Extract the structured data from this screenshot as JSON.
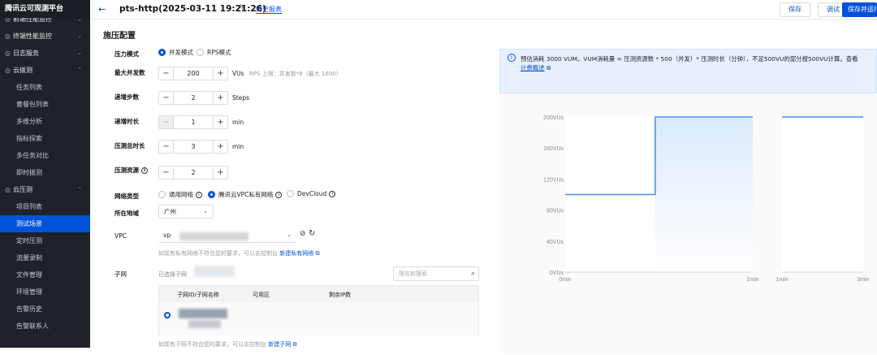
{
  "sidebar": {
    "logo": "腾讯云可观测平台",
    "items": [
      {
        "label": "前端性能监控",
        "kind": "group-cut",
        "icon": "web-icon"
      },
      {
        "label": "终端性能监控",
        "kind": "group",
        "icon": "terminal-icon"
      },
      {
        "label": "日志服务",
        "kind": "group",
        "icon": "log-icon"
      },
      {
        "label": "云拨测",
        "kind": "group-open",
        "icon": "dial-icon"
      },
      {
        "label": "任务列表",
        "kind": "sub"
      },
      {
        "label": "套餐包列表",
        "kind": "sub"
      },
      {
        "label": "多维分析",
        "kind": "sub"
      },
      {
        "label": "指标探索",
        "kind": "sub"
      },
      {
        "label": "多任务对比",
        "kind": "sub"
      },
      {
        "label": "即时拨测",
        "kind": "sub"
      },
      {
        "label": "云压测",
        "kind": "group-open",
        "icon": "stress-icon"
      },
      {
        "label": "项目列表",
        "kind": "sub"
      },
      {
        "label": "测试场景",
        "kind": "sub",
        "active": true
      },
      {
        "label": "定时压测",
        "kind": "sub"
      },
      {
        "label": "流量录制",
        "kind": "sub"
      },
      {
        "label": "文件管理",
        "kind": "sub"
      },
      {
        "label": "环境管理",
        "kind": "sub"
      },
      {
        "label": "告警历史",
        "kind": "sub"
      },
      {
        "label": "告警联系人",
        "kind": "sub"
      }
    ]
  },
  "header": {
    "back_icon": "arrow-left-icon",
    "title": "pts-http(2025-03-11 19:21:26)",
    "history_link": "历史报表",
    "buttons": {
      "save": "保存",
      "debug": "调试",
      "save_run": "保存并运行"
    }
  },
  "form": {
    "section_title": "施压配置",
    "mode": {
      "label": "压力模式",
      "options": [
        "并发模式",
        "RPS模式"
      ],
      "selected": 0
    },
    "max_concurrency": {
      "label": "最大并发数",
      "value": "200",
      "unit": "VUs",
      "hint": "RPS 上限：并发数*8（最大 1600）"
    },
    "ramp_steps": {
      "label": "递增步数",
      "value": "2",
      "unit": "Steps"
    },
    "ramp_duration": {
      "label": "递增时长",
      "value": "1",
      "unit": "min"
    },
    "total_duration": {
      "label": "压测总时长",
      "value": "3",
      "unit": "min"
    },
    "resources": {
      "label": "压测资源",
      "value": "2"
    },
    "network": {
      "label": "网络类型",
      "options": [
        "通用网络",
        "腾讯云VPC私有网络",
        "DevCloud"
      ],
      "selected": 1
    },
    "region": {
      "label": "所在地域",
      "value": "广州"
    },
    "vpc": {
      "label": "VPC",
      "value": "vp",
      "hint": "如现有私有网络不符合您的要求，可以去控制台",
      "link": "新建私有网络"
    },
    "subnet": {
      "label": "子网",
      "selected_text": "已选择子网",
      "search_placeholder": "搜名称搜索",
      "columns": [
        "子网ID/子网名称",
        "可用区",
        "剩余IP数"
      ],
      "hint": "如现有子网不符合您的要求，可以去控制台",
      "link": "新建子网"
    }
  },
  "notice": {
    "text": "预估消耗 3000 VUM。VUM消耗量 = 压测资源数 * 500（并发）* 压测时长（分钟），不足500VU的部分按500VU计算。查看",
    "link": "计费概述"
  },
  "chart_data": {
    "type": "area",
    "panels": [
      {
        "x_ticks": [
          "0min",
          "1min"
        ],
        "points": [
          [
            0,
            100
          ],
          [
            1,
            200
          ]
        ]
      },
      {
        "x_ticks": [
          "1min",
          "3min"
        ],
        "points": [
          [
            1,
            200
          ],
          [
            3,
            200
          ]
        ]
      }
    ],
    "y_ticks": [
      "0VUs",
      "40VUs",
      "80VUs",
      "120VUs",
      "160VUs",
      "200VUs"
    ],
    "ylim": [
      0,
      200
    ],
    "line_color": "#4a8ff0",
    "fill_color": "#dbe9fc"
  }
}
